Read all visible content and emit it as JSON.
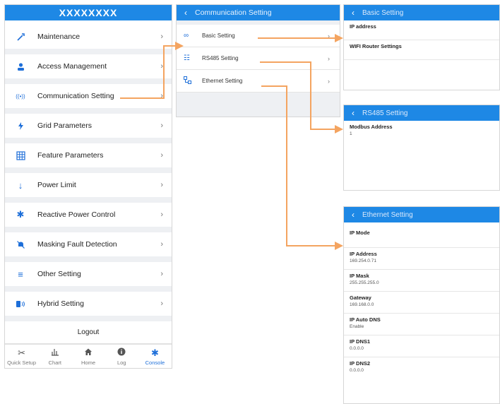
{
  "colors": {
    "accent": "#1e88e5",
    "arrow": "#f4a460",
    "icon": "#1e6fd9"
  },
  "main": {
    "title": "XXXXXXXX",
    "menu": [
      {
        "label": "Maintenance",
        "icon": "wrench-icon"
      },
      {
        "label": "Access Management",
        "icon": "user-icon"
      },
      {
        "label": "Communication Setting",
        "icon": "signal-icon"
      },
      {
        "label": "Grid Parameters",
        "icon": "lightning-icon"
      },
      {
        "label": "Feature Parameters",
        "icon": "grid-icon"
      },
      {
        "label": "Power Limit",
        "icon": "arrow-down-icon"
      },
      {
        "label": "Reactive Power Control",
        "icon": "gear-icon"
      },
      {
        "label": "Masking Fault Detection",
        "icon": "bell-off-icon"
      },
      {
        "label": "Other Setting",
        "icon": "list-icon"
      },
      {
        "label": "Hybrid Setting",
        "icon": "battery-icon"
      }
    ],
    "logout": "Logout",
    "tabs": [
      {
        "label": "Quick Setup",
        "icon": "tools-icon"
      },
      {
        "label": "Chart",
        "icon": "chart-icon"
      },
      {
        "label": "Home",
        "icon": "home-icon"
      },
      {
        "label": "Log",
        "icon": "info-icon"
      },
      {
        "label": "Console",
        "icon": "gear-icon"
      }
    ]
  },
  "communication": {
    "title": "Communication Setting",
    "items": [
      {
        "label": "Basic Setting",
        "icon": "link-icon"
      },
      {
        "label": "RS485 Setting",
        "icon": "sliders-icon"
      },
      {
        "label": "Ethernet Setting",
        "icon": "network-icon"
      }
    ]
  },
  "basic": {
    "title": "Basic Setting",
    "fields": [
      {
        "label": "IP address",
        "value": ""
      },
      {
        "label": "WIFI Router Settings",
        "value": ""
      }
    ]
  },
  "rs485": {
    "title": "RS485 Setting",
    "fields": [
      {
        "label": "Modbus Address",
        "value": "1"
      }
    ]
  },
  "ethernet": {
    "title": "Ethernet Setting",
    "fields": [
      {
        "label": "IP Mode",
        "value": ""
      },
      {
        "label": "IP Address",
        "value": "169.254.0.71"
      },
      {
        "label": "IP Mask",
        "value": "255.255.255.0"
      },
      {
        "label": "Gateway",
        "value": "169.168.0.0"
      },
      {
        "label": "IP Auto DNS",
        "value": "Enable"
      },
      {
        "label": "IP DNS1",
        "value": "0.0.0.0"
      },
      {
        "label": "IP DNS2",
        "value": "0.0.0.0"
      }
    ]
  }
}
